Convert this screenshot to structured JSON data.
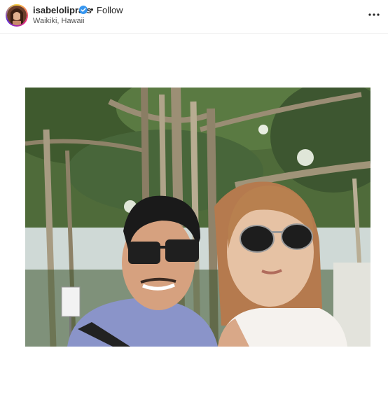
{
  "post": {
    "username": "isabeloliprats",
    "separator": "•",
    "follow_label": "Follow",
    "location": "Waikiki, Hawaii"
  },
  "icons": {
    "verified": "verified-badge-icon",
    "more": "more-options-icon"
  },
  "colors": {
    "verified_blue": "#3897f0",
    "text": "#262626",
    "border": "#efefef"
  }
}
